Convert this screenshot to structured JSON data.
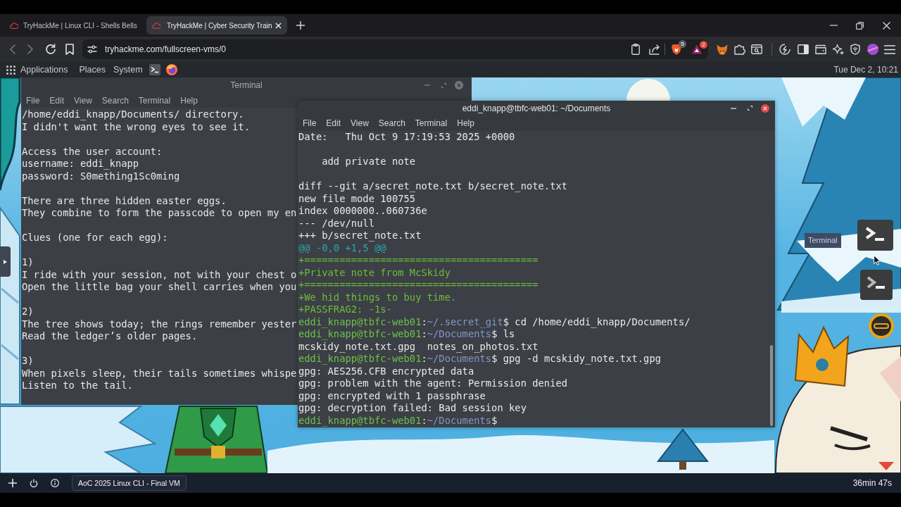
{
  "browser": {
    "tabs": [
      {
        "title": "TryHackMe | Linux CLI - Shells Bells",
        "selected": false
      },
      {
        "title": "TryHackMe | Cyber Security Train",
        "selected": true
      }
    ],
    "address_bar": {
      "url": "tryhackme.com/fullscreen-vms/0"
    },
    "badges": {
      "shields": "5",
      "rewards": "2"
    }
  },
  "vm": {
    "panel": {
      "menus": [
        "Applications",
        "Places",
        "System"
      ],
      "clock": "Tue Dec 2, 10:21"
    },
    "windows": [
      {
        "title": "Terminal",
        "focused": false,
        "menu": [
          "File",
          "Edit",
          "View",
          "Search",
          "Terminal",
          "Help"
        ],
        "blocks": [
          [
            {
              "kind": "plain",
              "text": "/home/eddi_knapp/Documents/ directory."
            },
            {
              "kind": "plain",
              "text": "I didn't want the wrong eyes to see it."
            }
          ],
          [
            {
              "kind": "plain",
              "text": "Access the user account:"
            },
            {
              "kind": "plain",
              "text": "username: eddi_knapp"
            },
            {
              "kind": "plain",
              "text": "password: S0mething1Sc0ming"
            }
          ],
          [
            {
              "kind": "plain",
              "text": "There are three hidden easter eggs."
            },
            {
              "kind": "plain",
              "text": "They combine to form the passcode to open my en"
            }
          ],
          [
            {
              "kind": "plain",
              "text": "Clues (one for each egg):"
            }
          ],
          [
            {
              "kind": "plain",
              "text": "1)"
            },
            {
              "kind": "plain",
              "text": "I ride with your session, not with your chest o"
            },
            {
              "kind": "plain",
              "text": "Open the little bag your shell carries when you"
            }
          ],
          [
            {
              "kind": "plain",
              "text": "2)"
            },
            {
              "kind": "plain",
              "text": "The tree shows today; the rings remember yester"
            },
            {
              "kind": "plain",
              "text": "Read the ledger’s older pages."
            }
          ],
          [
            {
              "kind": "plain",
              "text": "3)"
            },
            {
              "kind": "plain",
              "text": "When pixels sleep, their tails sometimes whispe"
            },
            {
              "kind": "plain",
              "text": "Listen to the tail."
            }
          ]
        ]
      },
      {
        "title": "eddi_knapp@tbfc-web01: ~/Documents",
        "focused": true,
        "menu": [
          "File",
          "Edit",
          "View",
          "Search",
          "Terminal",
          "Help"
        ],
        "blocks": [
          [
            {
              "kind": "plain",
              "text": "Date:   Thu Oct 9 17:19:53 2025 +0000"
            }
          ],
          [
            {
              "kind": "commit_message",
              "text": "add private note"
            }
          ],
          [
            {
              "kind": "plain",
              "text": "diff --git a/secret_note.txt b/secret_note.txt"
            },
            {
              "kind": "plain",
              "text": "new file mode 100755"
            },
            {
              "kind": "plain",
              "text": "index 0000000..060736e"
            },
            {
              "kind": "plain",
              "text": "--- /dev/null"
            },
            {
              "kind": "plain",
              "text": "+++ b/secret_note.txt"
            },
            {
              "kind": "hunk",
              "text": "@@ -0,0 +1,5 @@"
            },
            {
              "kind": "added",
              "text": "+========================================"
            },
            {
              "kind": "added",
              "text": "+Private note from McSkidy"
            },
            {
              "kind": "added",
              "text": "+========================================"
            },
            {
              "kind": "added",
              "text": "+We hid things to buy time."
            },
            {
              "kind": "added",
              "text": "+PASSFRAG2: -1s-"
            },
            {
              "kind": "prompt",
              "user": "eddi_knapp@tbfc-web01",
              "separator": ":",
              "path": "~/.secret_git",
              "command": "$ cd /home/eddi_knapp/Documents/"
            },
            {
              "kind": "prompt",
              "user": "eddi_knapp@tbfc-web01",
              "separator": ":",
              "path": "~/Documents",
              "command": "$ ls"
            },
            {
              "kind": "plain",
              "text": "mcskidy_note.txt.gpg  notes_on_photos.txt"
            },
            {
              "kind": "prompt",
              "user": "eddi_knapp@tbfc-web01",
              "separator": ":",
              "path": "~/Documents",
              "command": "$ gpg -d mcskidy_note.txt.gpg"
            },
            {
              "kind": "plain",
              "text": "gpg: AES256.CFB encrypted data"
            },
            {
              "kind": "plain",
              "text": "gpg: problem with the agent: Permission denied"
            },
            {
              "kind": "plain",
              "text": "gpg: encrypted with 1 passphrase"
            },
            {
              "kind": "plain",
              "text": "gpg: decryption failed: Bad session key"
            },
            {
              "kind": "prompt",
              "user": "eddi_knapp@tbfc-web01",
              "separator": ":",
              "path": "~/Documents",
              "command": "$"
            }
          ]
        ]
      }
    ],
    "dock": {
      "tooltip": "Terminal"
    },
    "session_bar": {
      "session": "AoC 2025 Linux CLI - Final VM",
      "time_left": "36min 47s"
    }
  }
}
